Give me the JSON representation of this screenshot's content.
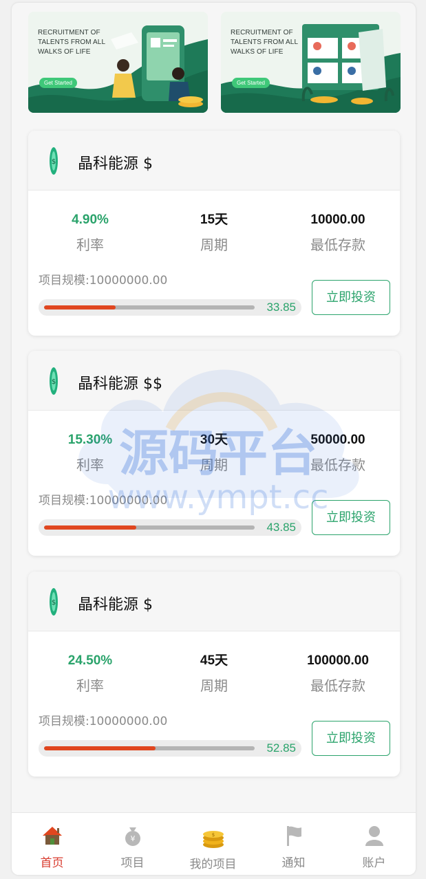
{
  "banners": [
    {
      "text": "RECRUITMENT OF TALENTS FROM ALL WALKS OF LIFE",
      "button": "Get Started"
    },
    {
      "text": "RECRUITMENT OF TALENTS FROM ALL WALKS OF LIFE",
      "button": "Get Started"
    }
  ],
  "labels": {
    "rate": "利率",
    "period": "周期",
    "min_deposit": "最低存款",
    "invest_button": "立即投资"
  },
  "projects": [
    {
      "title": "晶科能源 $",
      "rate": "4.90%",
      "period": "15天",
      "min_deposit": "10000.00",
      "scale": "项目规模:10000000.00",
      "progress": 33.85,
      "progress_label": "33.85"
    },
    {
      "title": "晶科能源 $$",
      "rate": "15.30%",
      "period": "30天",
      "min_deposit": "50000.00",
      "scale": "项目规模:10000000.00",
      "progress": 43.85,
      "progress_label": "43.85"
    },
    {
      "title": "晶科能源 $",
      "rate": "24.50%",
      "period": "45天",
      "min_deposit": "100000.00",
      "scale": "项目规模:10000000.00",
      "progress": 52.85,
      "progress_label": "52.85"
    }
  ],
  "watermark": {
    "line1": "源码平台",
    "line2": "www.ympt.cc"
  },
  "tabbar": [
    {
      "label": "首页",
      "icon": "home-icon",
      "active": true
    },
    {
      "label": "项目",
      "icon": "money-bag-icon",
      "active": false
    },
    {
      "label": "我的项目",
      "icon": "gold-coins-icon",
      "active": false
    },
    {
      "label": "通知",
      "icon": "flag-icon",
      "active": false
    },
    {
      "label": "账户",
      "icon": "user-icon",
      "active": false
    }
  ],
  "colors": {
    "accent_green": "#2aa36b",
    "progress_red": "#e0461f",
    "active_tab": "#d83b2e",
    "banner_green": "#1f7a5a"
  }
}
